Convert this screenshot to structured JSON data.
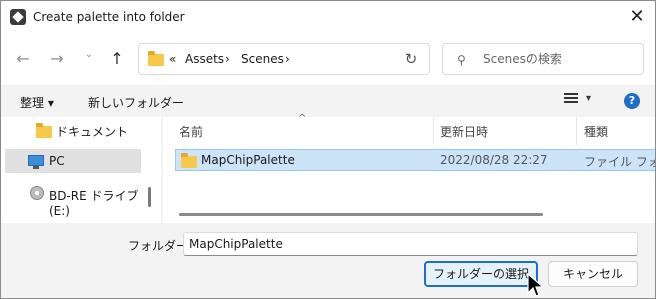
{
  "window": {
    "title": "Create palette into folder",
    "close_glyph": "✕"
  },
  "nav": {
    "back_glyph": "←",
    "forward_glyph": "→",
    "recent_glyph": "⌄",
    "up_glyph": "↑",
    "breadcrumb_overflow": "«",
    "breadcrumbs": [
      "Assets",
      "Scenes"
    ],
    "separator": "›",
    "refresh_glyph": "↻",
    "search_placeholder": "Scenesの検索",
    "search_glyph": "⚲"
  },
  "toolbar": {
    "organize_label": "整理 ▾",
    "new_folder_label": "新しいフォルダー",
    "view_caret": "▾",
    "help_glyph": "?"
  },
  "sidebar": {
    "items": [
      {
        "label": "ドキュメント",
        "icon": "folder-icon"
      },
      {
        "label": "PC",
        "icon": "pc-icon",
        "selected": true
      },
      {
        "label": "BD-RE ドライブ (E:)",
        "icon": "disc-drive-icon"
      }
    ]
  },
  "file_list": {
    "sort_glyph": "^",
    "columns": [
      "名前",
      "更新日時",
      "種類"
    ],
    "rows": [
      {
        "name": "MapChipPalette",
        "modified": "2022/08/28 22:27",
        "type": "ファイル フォルダー",
        "selected": true
      }
    ]
  },
  "footer": {
    "folder_label": "フォルダー:",
    "folder_value": "MapChipPalette",
    "select_button": "フォルダーの選択",
    "cancel_button": "キャンセル"
  },
  "colors": {
    "accent": "#1e6dc8",
    "selection": "#cce4f7",
    "folder": "#f8c84d"
  }
}
